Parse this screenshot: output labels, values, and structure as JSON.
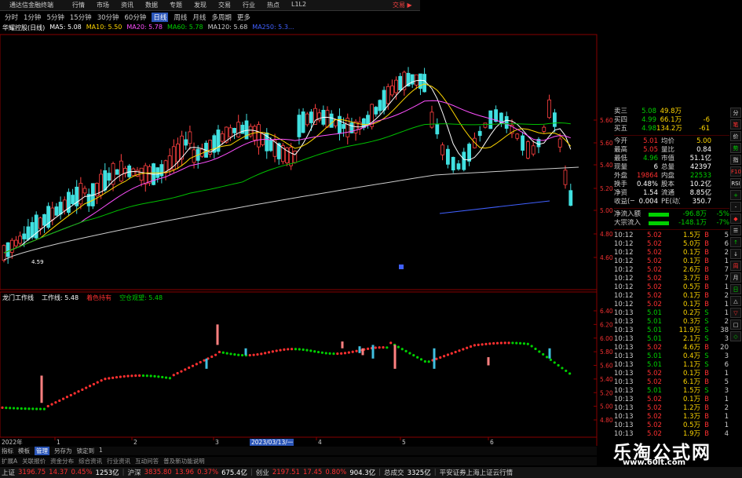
{
  "app": {
    "title": "通达信金融终端",
    "menus": [
      "行情",
      "市场",
      "资讯",
      "数据",
      "专题",
      "发现",
      "交易",
      "行业",
      "热点",
      "L1L2"
    ],
    "right_menu": "交易 ▶"
  },
  "periods": [
    "分时",
    "1分钟",
    "5分钟",
    "15分钟",
    "30分钟",
    "60分钟",
    "日线",
    "周线",
    "月线",
    "多周期",
    "更多"
  ],
  "active_period": "日线",
  "kline_legend": {
    "stock": "华耀控股(日线)",
    "ma5": "MA5: 5.08",
    "ma10": "MA10: 5.50",
    "ma20": "MA20: 5.78",
    "ma60": "MA60: 5.78",
    "ma120": "MA120: 5.68",
    "ma250": "MA250: 5.3..."
  },
  "indicator_legend": {
    "name": "龙门工作线",
    "work_line": "工作线: 5.48",
    "up_label": "着色持有",
    "down_label": "空仓观望: 5.48"
  },
  "price_axis": [
    "5.60",
    "5.60",
    "5.40",
    "5.20",
    "5.00",
    "4.80",
    "4.60"
  ],
  "indicator_axis": [
    "6.40",
    "6.20",
    "6.00",
    "5.80",
    "5.60",
    "5.40",
    "5.20",
    "5.00",
    "4.80"
  ],
  "low_mark": "4.59",
  "date_axis": {
    "start": "2022年",
    "ticks": [
      "1",
      "2",
      "3",
      "4",
      "5",
      "6"
    ],
    "cursor": "2023/03/13/一"
  },
  "bottom_tabs": [
    "指标",
    "模板",
    "管理",
    "另存为",
    "锁定到",
    "1"
  ],
  "active_tab": "管理",
  "func_tabs": [
    "扩展A",
    "关联报价",
    "资金分布",
    "综合资讯",
    "行业资讯",
    "互动问答",
    "普及新功能说明"
  ],
  "quote": {
    "bids": [
      {
        "label": "卖三",
        "price": "5.08",
        "vol": "49.8万",
        "d": "",
        "e": ""
      },
      {
        "label": "买四",
        "price": "4.99",
        "vol": "66.1万",
        "d": "",
        "e": "-6"
      },
      {
        "label": "买五",
        "price": "4.98",
        "vol": "134.2万",
        "d": "",
        "e": "-61"
      }
    ],
    "stats": [
      {
        "k1": "今开",
        "v1": "5.01",
        "k2": "均价",
        "v2": "5.00"
      },
      {
        "k1": "最高",
        "v1": "5.05",
        "k2": "量比",
        "v2": "0.84"
      },
      {
        "k1": "最低",
        "v1": "4.96",
        "k2": "市值",
        "v2": "51.1亿"
      },
      {
        "k1": "现量",
        "v1": "6",
        "k2": "总量",
        "v2": "42397"
      },
      {
        "k1": "外盘",
        "v1": "19864",
        "k2": "内盘",
        "v2": "22533"
      },
      {
        "k1": "换手",
        "v1": "0.48%",
        "k2": "股本",
        "v2": "10.2亿"
      },
      {
        "k1": "净资",
        "v1": "1.54",
        "k2": "流通",
        "v2": "8.85亿"
      },
      {
        "k1": "收益(一)",
        "v1": "0.004",
        "k2": "PE(动)",
        "v2": "350.7"
      }
    ],
    "flow": [
      {
        "label": "净流入额",
        "value": "-96.8万",
        "pct": "-5%"
      },
      {
        "label": "大宗流入",
        "value": "-148.1万",
        "pct": "-7%"
      }
    ],
    "ticks": [
      {
        "t": "10:12",
        "p": "5.02",
        "v": "1.5万",
        "s": "B",
        "n": "5"
      },
      {
        "t": "10:12",
        "p": "5.02",
        "v": "5.0万",
        "s": "B",
        "n": "6"
      },
      {
        "t": "10:12",
        "p": "5.02",
        "v": "0.1万",
        "s": "B",
        "n": "2"
      },
      {
        "t": "10:12",
        "p": "5.02",
        "v": "0.1万",
        "s": "B",
        "n": "1"
      },
      {
        "t": "10:12",
        "p": "5.02",
        "v": "2.6万",
        "s": "B",
        "n": "7"
      },
      {
        "t": "10:12",
        "p": "5.02",
        "v": "3.7万",
        "s": "B",
        "n": "7"
      },
      {
        "t": "10:12",
        "p": "5.02",
        "v": "0.5万",
        "s": "B",
        "n": "1"
      },
      {
        "t": "10:12",
        "p": "5.02",
        "v": "0.1万",
        "s": "B",
        "n": "2"
      },
      {
        "t": "10:12",
        "p": "5.02",
        "v": "0.1万",
        "s": "B",
        "n": "1"
      },
      {
        "t": "10:13",
        "p": "5.01",
        "v": "0.2万",
        "s": "S",
        "n": "1"
      },
      {
        "t": "10:13",
        "p": "5.01",
        "v": "0.3万",
        "s": "S",
        "n": "2"
      },
      {
        "t": "10:13",
        "p": "5.01",
        "v": "11.9万",
        "s": "S",
        "n": "38"
      },
      {
        "t": "10:13",
        "p": "5.01",
        "v": "2.1万",
        "s": "S",
        "n": "3"
      },
      {
        "t": "10:13",
        "p": "5.02",
        "v": "4.6万",
        "s": "B",
        "n": "20"
      },
      {
        "t": "10:13",
        "p": "5.01",
        "v": "0.4万",
        "s": "S",
        "n": "3"
      },
      {
        "t": "10:13",
        "p": "5.01",
        "v": "1.1万",
        "s": "S",
        "n": "6"
      },
      {
        "t": "10:13",
        "p": "5.02",
        "v": "0.1万",
        "s": "B",
        "n": "1"
      },
      {
        "t": "10:13",
        "p": "5.02",
        "v": "6.1万",
        "s": "B",
        "n": "5"
      },
      {
        "t": "10:13",
        "p": "5.01",
        "v": "1.5万",
        "s": "S",
        "n": "3"
      },
      {
        "t": "10:13",
        "p": "5.02",
        "v": "0.1万",
        "s": "B",
        "n": "1"
      },
      {
        "t": "10:13",
        "p": "5.02",
        "v": "1.2万",
        "s": "B",
        "n": "2"
      },
      {
        "t": "10:13",
        "p": "5.02",
        "v": "1.3万",
        "s": "B",
        "n": "1"
      },
      {
        "t": "10:13",
        "p": "5.02",
        "v": "0.5万",
        "s": "B",
        "n": "1"
      },
      {
        "t": "10:13",
        "p": "5.02",
        "v": "1.9万",
        "s": "B",
        "n": "4"
      }
    ]
  },
  "toolstrip": [
    "分",
    "笔",
    "价",
    "势",
    "指",
    "F10",
    "RSI",
    "+",
    "-",
    "◆",
    "☰",
    "↑",
    "↓",
    "周",
    "月",
    "日",
    "△",
    "▽",
    "□",
    "◇"
  ],
  "ticker": {
    "sh_label": "上证",
    "sh_val": "3196.75",
    "sh_chg": "14.37",
    "sh_pct": "0.45%",
    "sh_amt": "1253亿",
    "sz_label": "沪深",
    "sz_val": "3835.80",
    "sz_chg": "13.96",
    "sz_pct": "0.37%",
    "sz_amt": "675.4亿",
    "cy_label": "创业",
    "cy_val": "2197.51",
    "cy_chg": "17.45",
    "cy_pct": "0.80%",
    "cy_amt": "904.3亿",
    "total_label": "总成交",
    "total_val": "3325亿",
    "broker": "平安证券上海上证云行情"
  },
  "watermark": {
    "main": "乐淘公式网",
    "url": "www.60lt.com"
  },
  "bottom_right_label": "图文F10"
}
